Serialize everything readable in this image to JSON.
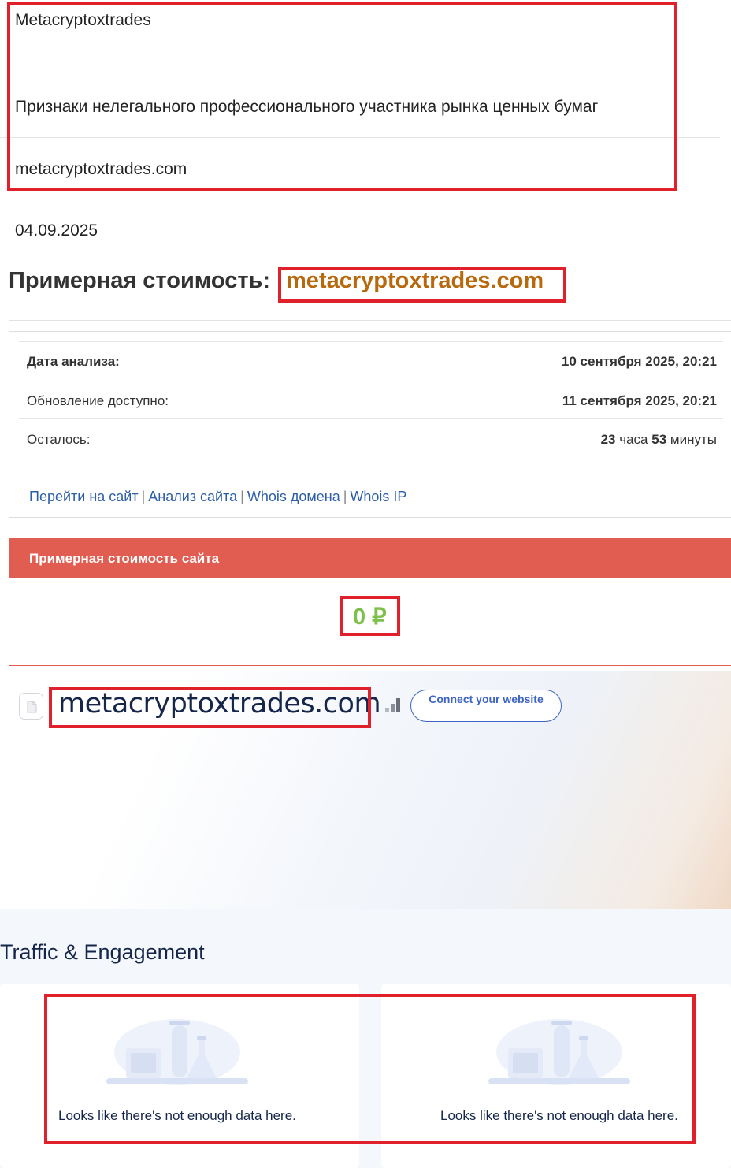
{
  "info_table": {
    "name": "Metacryptoxtrades",
    "sign": "Признаки нелегального профессионального участника рынка ценных бумаг",
    "domain": "metacryptoxtrades.com"
  },
  "date": "04.09.2025",
  "price_header": {
    "label": "Примерная стоимость:",
    "domain": "metacryptoxtrades.com"
  },
  "analysis": {
    "rows": [
      {
        "label": "Дата анализа:",
        "value": "10 сентября 2025, 20:21"
      },
      {
        "label": "Обновление доступно:",
        "value": "11 сентября 2025, 20:21"
      }
    ],
    "remaining_label": "Осталось:",
    "remaining": {
      "hours": "23",
      "hours_unit": "часа",
      "minutes": "53",
      "minutes_unit": "минуты"
    },
    "links": [
      "Перейти на сайт",
      "Анализ сайта",
      "Whois домена",
      "Whois IP"
    ],
    "link_separator": "|"
  },
  "site_cost": {
    "header": "Примерная стоимость сайта",
    "value": "0 ₽"
  },
  "hero": {
    "domain": "metacryptoxtrades.com",
    "connect_button": "Connect your website"
  },
  "traffic": {
    "title": "Traffic & Engagement",
    "cards": [
      {
        "message": "Looks like there's not enough data here."
      },
      {
        "message": "Looks like there's not enough data here."
      }
    ]
  },
  "colors": {
    "highlight_box": "#e0202b",
    "domain_orange": "#b8690e",
    "cost_header": "#e25d51",
    "cost_value": "#7dc04a",
    "link_blue": "#2d5ea8",
    "connect_blue": "#3e64c4",
    "navy_text": "#15264a"
  }
}
